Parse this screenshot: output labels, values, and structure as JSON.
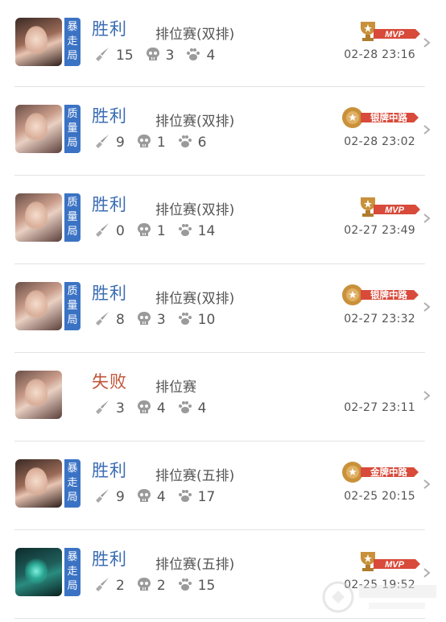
{
  "matches": [
    {
      "result": "胜利",
      "result_type": "win",
      "mode_tag": "暴走局",
      "mode_chars": [
        "暴",
        "走",
        "局"
      ],
      "queue": "排位赛(双排)",
      "kills": "15",
      "deaths": "3",
      "assists": "4",
      "badge": "MVP",
      "time": "02-28 23:16",
      "avatar": "dark"
    },
    {
      "result": "胜利",
      "result_type": "win",
      "mode_tag": "质量局",
      "mode_chars": [
        "质",
        "量",
        "局"
      ],
      "queue": "排位赛(双排)",
      "kills": "9",
      "deaths": "1",
      "assists": "6",
      "badge": "银牌中路",
      "time": "02-28 23:02",
      "avatar": "light"
    },
    {
      "result": "胜利",
      "result_type": "win",
      "mode_tag": "质量局",
      "mode_chars": [
        "质",
        "量",
        "局"
      ],
      "queue": "排位赛(双排)",
      "kills": "0",
      "deaths": "1",
      "assists": "14",
      "badge": "MVP",
      "time": "02-27 23:49",
      "avatar": "light"
    },
    {
      "result": "胜利",
      "result_type": "win",
      "mode_tag": "质量局",
      "mode_chars": [
        "质",
        "量",
        "局"
      ],
      "queue": "排位赛(双排)",
      "kills": "8",
      "deaths": "3",
      "assists": "10",
      "badge": "银牌中路",
      "time": "02-27 23:32",
      "avatar": "light"
    },
    {
      "result": "失败",
      "result_type": "loss",
      "mode_tag": "",
      "mode_chars": [],
      "queue": "排位赛",
      "kills": "3",
      "deaths": "4",
      "assists": "4",
      "badge": "",
      "time": "02-27 23:11",
      "avatar": "light"
    },
    {
      "result": "胜利",
      "result_type": "win",
      "mode_tag": "暴走局",
      "mode_chars": [
        "暴",
        "走",
        "局"
      ],
      "queue": "排位赛(五排)",
      "kills": "9",
      "deaths": "4",
      "assists": "17",
      "badge": "金牌中路",
      "time": "02-25 20:15",
      "avatar": "dark"
    },
    {
      "result": "胜利",
      "result_type": "win",
      "mode_tag": "暴走局",
      "mode_chars": [
        "暴",
        "走",
        "局"
      ],
      "queue": "排位赛(五排)",
      "kills": "2",
      "deaths": "2",
      "assists": "15",
      "badge": "MVP",
      "time": "02-25 19:52",
      "avatar": "mech"
    }
  ],
  "icons": {
    "kills": "sword-icon",
    "deaths": "skull-icon",
    "assists": "paw-icon",
    "detail": "chevron-right-icon"
  },
  "colors": {
    "win": "#3b6db3",
    "loss": "#c0553a",
    "mode_tag": "#3b73c4",
    "badge_red": "#d84a3a",
    "badge_gold": "#c9913a"
  }
}
